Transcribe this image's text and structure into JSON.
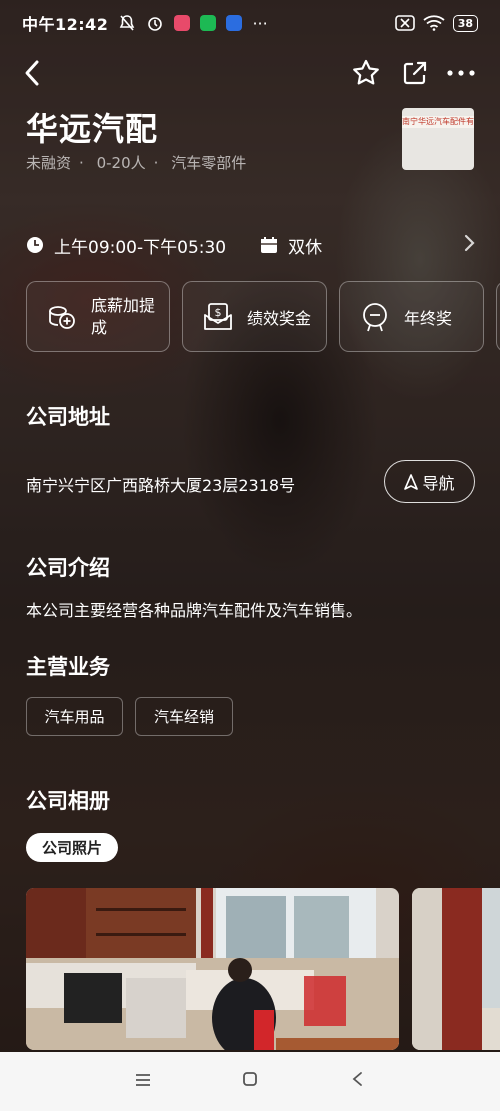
{
  "status_bar": {
    "time": "中午12:42",
    "battery": "38"
  },
  "company": {
    "name": "华远汽配",
    "funding": "未融资",
    "size": "0-20人",
    "industry": "汽车零部件",
    "logo_text": "南宁华远汽车配件有限公司"
  },
  "schedule": {
    "hours": "上午09:00-下午05:30",
    "rest": "双休"
  },
  "benefits": [
    {
      "label": "底薪加提成",
      "icon": "coins-plus-icon"
    },
    {
      "label": "绩效奖金",
      "icon": "money-envelope-icon"
    },
    {
      "label": "年终奖",
      "icon": "medal-icon"
    }
  ],
  "sections": {
    "address_title": "公司地址",
    "intro_title": "公司介绍",
    "business_title": "主营业务",
    "album_title": "公司相册"
  },
  "address": "南宁兴宁区广西路桥大厦23层2318号",
  "navigate_label": "导航",
  "intro": "本公司主要经营各种品牌汽车配件及汽车销售。",
  "business_tags": [
    "汽车用品",
    "汽车经销"
  ],
  "album": {
    "tab": "公司照片"
  },
  "colors": {
    "accent": "#ffffff",
    "bottom_bar": "#f6f6f6"
  }
}
